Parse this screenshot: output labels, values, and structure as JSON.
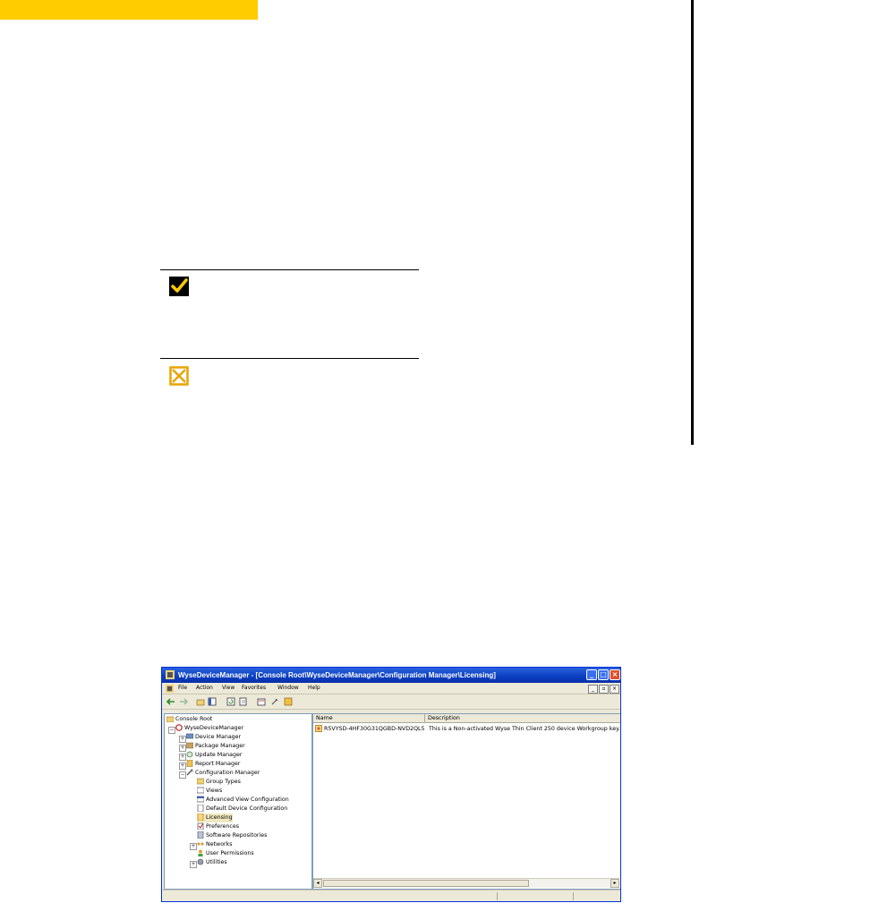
{
  "window": {
    "title": "WyseDeviceManager - [Console Root\\WyseDeviceManager\\Configuration Manager\\Licensing]",
    "menu": [
      "File",
      "Action",
      "View",
      "Favorites",
      "Window",
      "Help"
    ],
    "tree": [
      {
        "label": "Console Root",
        "icon": "folder-icon"
      },
      {
        "label": "WyseDeviceManager",
        "icon": "wyse-logo-icon"
      },
      {
        "label": "Device Manager",
        "icon": "device-manager-icon"
      },
      {
        "label": "Package Manager",
        "icon": "package-manager-icon"
      },
      {
        "label": "Update Manager",
        "icon": "update-manager-icon"
      },
      {
        "label": "Report Manager",
        "icon": "report-manager-icon"
      },
      {
        "label": "Configuration Manager",
        "icon": "wrench-icon"
      },
      {
        "label": "Group Types",
        "icon": "group-types-icon"
      },
      {
        "label": "Views",
        "icon": "views-icon"
      },
      {
        "label": "Advanced View Configuration",
        "icon": "advanced-view-icon"
      },
      {
        "label": "Default Device Configuration",
        "icon": "default-config-icon"
      },
      {
        "label": "Licensing",
        "icon": "licensing-icon"
      },
      {
        "label": "Preferences",
        "icon": "preferences-icon"
      },
      {
        "label": "Software Repositories",
        "icon": "repository-icon"
      },
      {
        "label": "Networks",
        "icon": "networks-icon"
      },
      {
        "label": "User Permissions",
        "icon": "user-permissions-icon"
      },
      {
        "label": "Utilities",
        "icon": "utilities-icon"
      }
    ],
    "list": {
      "columns": [
        "Name",
        "Description"
      ],
      "rows": [
        {
          "name": "R5VYSD-4HF30G31QGBD-NVD2QL5",
          "description": "This is a Non-activated Wyse Thin Client 250 device Workgroup key. Th"
        }
      ]
    }
  },
  "decor": {
    "check_icon": "checkmark-icon",
    "cross_icon": "cross-box-icon",
    "accent": "#ffcc00"
  }
}
